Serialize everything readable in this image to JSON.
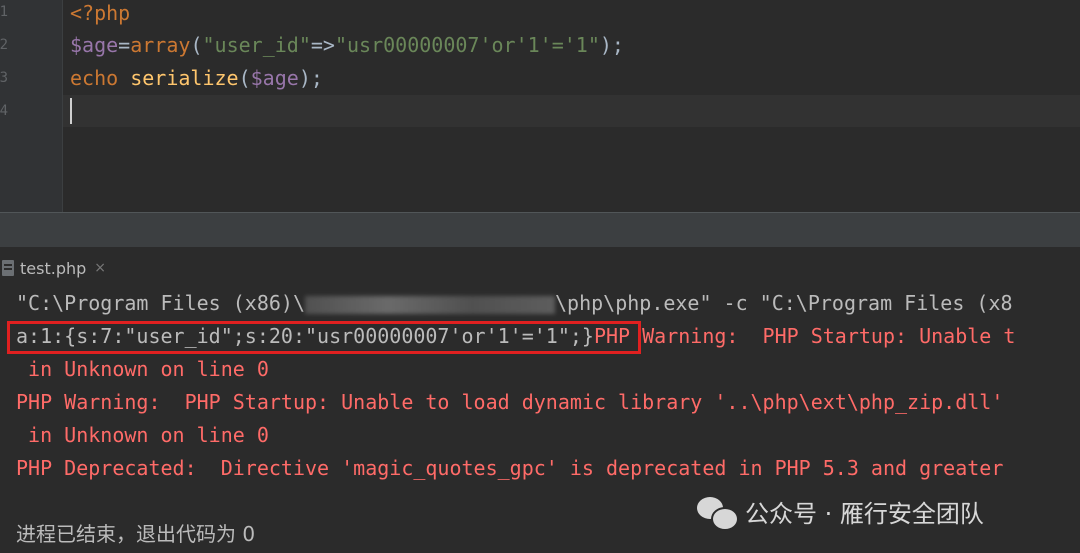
{
  "editor": {
    "line_numbers": [
      "1",
      "2",
      "3",
      "4"
    ],
    "code": {
      "line1": "<?php",
      "line2": {
        "var": "$age",
        "eq": "=",
        "func": "array",
        "open": "(",
        "key": "\"user_id\"",
        "arrow": "=>",
        "value": "\"usr00000007'or'1'='1\"",
        "close": ");"
      },
      "line3": {
        "kw": "echo",
        "func": "serialize",
        "open": "(",
        "var": "$age",
        "close": ");"
      }
    }
  },
  "run_panel": {
    "tab_label": "test.php",
    "tab_close": "×",
    "command": {
      "prefix": "\"C:\\Program Files (x86)\\",
      "suffix": "\\php\\php.exe\" -c \"C:\\Program Files (x8"
    },
    "output": {
      "serialized": "a:1:{s:7:\"user_id\";s:20:\"usr00000007'or'1'='1\";}",
      "warning_tail": "PHP Warning:  PHP Startup: Unable t",
      "line_a": " in Unknown on line 0",
      "warning_2": "PHP Warning:  PHP Startup: Unable to load dynamic library '..\\php\\ext\\php_zip.dll'",
      "line_b": " in Unknown on line 0",
      "deprecated": "PHP Deprecated:  Directive 'magic_quotes_gpc' is deprecated in PHP 5.3 and greater"
    },
    "finished": "进程已结束，退出代码为 0"
  },
  "watermark": {
    "text": "公众号 · 雁行安全团队",
    "icon": "wechat-icon"
  },
  "colors": {
    "background": "#2b2b2b",
    "keyword": "#cc7832",
    "variable": "#9876aa",
    "function": "#ffc66d",
    "string": "#6a8759",
    "error": "#ff6b68",
    "highlight_box": "#e02020"
  }
}
